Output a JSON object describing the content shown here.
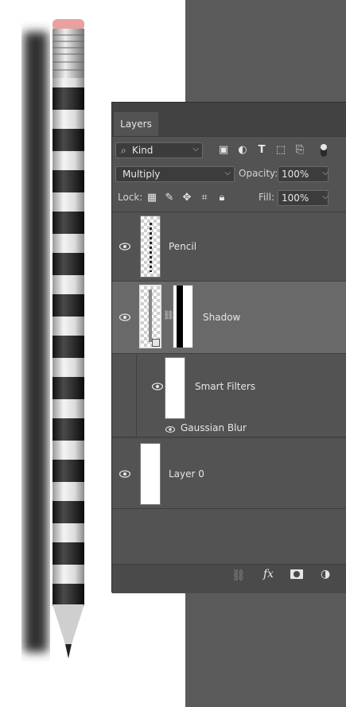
{
  "panel": {
    "tab_label": "Layers",
    "filter": {
      "kind_label": "Kind",
      "icons": [
        "search-icon",
        "image-filter-icon",
        "adjustment-filter-icon",
        "type-filter-icon",
        "shape-filter-icon",
        "smart-object-filter-icon",
        "filter-toggle-icon"
      ]
    },
    "blend_mode": "Multiply",
    "opacity_label": "Opacity:",
    "opacity_value": "100%",
    "lock_label": "Lock:",
    "fill_label": "Fill:",
    "fill_value": "100%",
    "layers": [
      {
        "name": "Pencil"
      },
      {
        "name": "Shadow",
        "selected": true
      },
      {
        "name": "Smart Filters"
      },
      {
        "name": "Gaussian Blur"
      },
      {
        "name": "Layer 0"
      }
    ],
    "footer_icons": [
      "link-layers-icon",
      "fx-icon",
      "add-mask-icon",
      "new-adjustment-icon"
    ],
    "footer_fx_label": "fx"
  },
  "colors": {
    "panel_bg": "#535353",
    "selected_row": "#696969",
    "canvas_gray": "#5a5a5a",
    "eraser": "#e8a0a0"
  }
}
